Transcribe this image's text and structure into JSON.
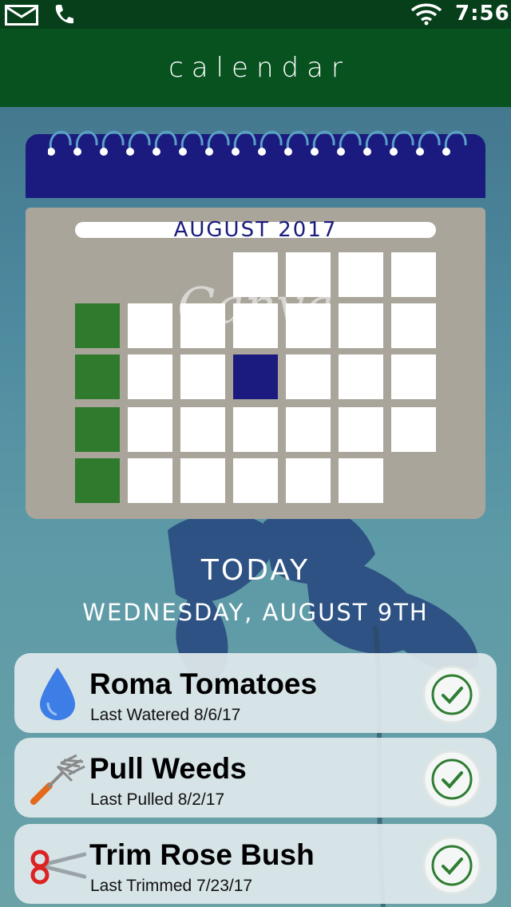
{
  "status_bar": {
    "time": "7:56"
  },
  "app_bar": {
    "title": "calendar"
  },
  "calendar_graphic": {
    "month_label": "AUGUST 2017",
    "watermark": "Canva"
  },
  "today": {
    "label": "TODAY",
    "date": "WEDNESDAY, AUGUST 9TH"
  },
  "tasks": [
    {
      "title": "Roma Tomatoes",
      "subtitle": "Last Watered 8/6/17",
      "icon": "water-drop-icon"
    },
    {
      "title": "Pull Weeds",
      "subtitle": "Last Pulled 8/2/17",
      "icon": "garden-fork-icon"
    },
    {
      "title": "Trim Rose Bush",
      "subtitle": "Last Trimmed 7/23/17",
      "icon": "scissors-icon"
    }
  ],
  "colors": {
    "app_bar": "#07521f",
    "calendar_blue": "#1b1a7e",
    "calendar_green": "#2f7a2c",
    "check_green": "#2e7d32"
  }
}
